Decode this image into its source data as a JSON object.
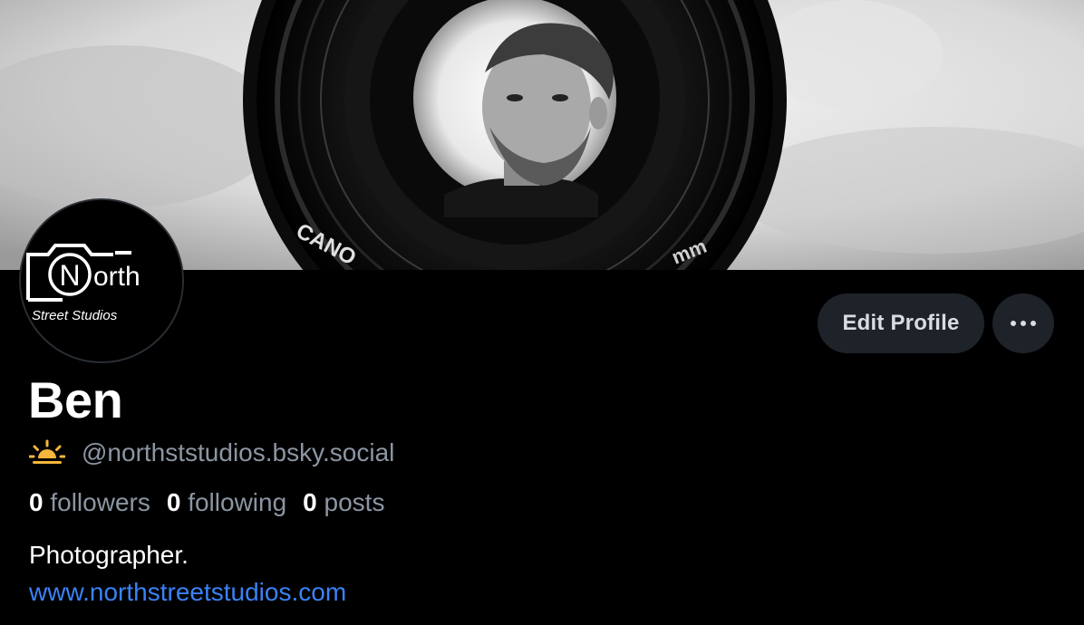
{
  "profile": {
    "display_name": "Ben",
    "handle": "@northststudios.bsky.social",
    "bio": "Photographer.",
    "website": "www.northstreetstudios.com",
    "status_icon": "sun-horizon-icon"
  },
  "stats": {
    "followers_count": "0",
    "followers_label": "followers",
    "following_count": "0",
    "following_label": "following",
    "posts_count": "0",
    "posts_label": "posts"
  },
  "actions": {
    "edit_label": "Edit Profile",
    "more_icon": "more-dots-icon"
  },
  "avatar": {
    "logo_top": "North",
    "logo_bottom": "Street Studios"
  },
  "banner": {
    "lens_text_left": "CANO",
    "lens_text_right": "mm"
  },
  "colors": {
    "background": "#000000",
    "button_bg": "#1e2329",
    "muted_text": "#8c96a3",
    "link": "#3b82f6",
    "sun": "#f5b73b"
  }
}
